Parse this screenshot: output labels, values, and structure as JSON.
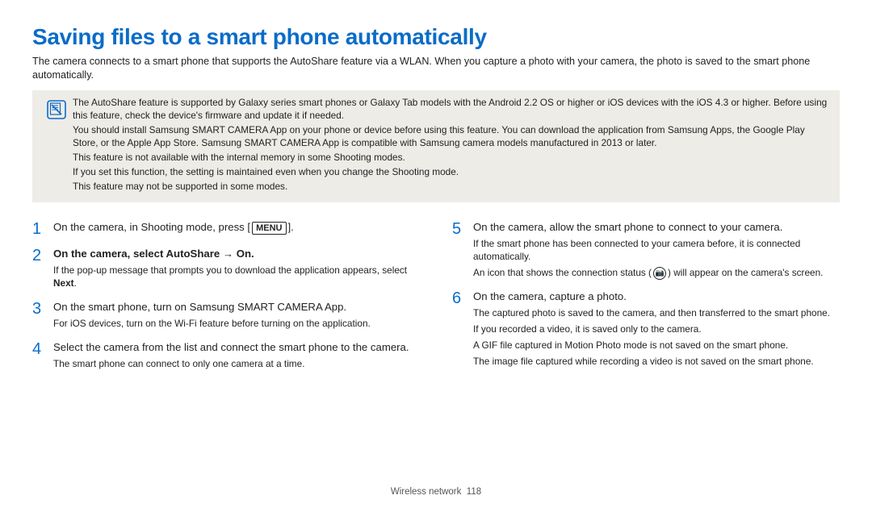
{
  "title": "Saving files to a smart phone automatically",
  "intro": "The camera connects to a smart phone that supports the AutoShare feature via a WLAN. When you capture a photo with your camera, the photo is saved to the smart phone automatically.",
  "note": {
    "lines": [
      "The AutoShare feature is supported by Galaxy series smart phones or Galaxy Tab models with the Android 2.2 OS or higher or iOS devices with the iOS 4.3 or higher. Before using this feature, check the device's firmware and update it if needed.",
      "You should install Samsung SMART CAMERA App on your phone or device before using this feature. You can download the application from Samsung Apps, the Google Play Store, or the Apple App Store. Samsung SMART CAMERA App is compatible with Samsung camera models manufactured in 2013 or later.",
      "This feature is not available with the internal memory in some Shooting modes.",
      "If you set this function, the setting is maintained even when you change the Shooting mode.",
      "This feature may not be supported in some modes."
    ]
  },
  "steps_left": [
    {
      "num": "1",
      "text_pre": "On the camera, in Shooting mode, press [",
      "icon": "MENU",
      "text_post": "].",
      "sub": ""
    },
    {
      "num": "2",
      "text_pre": "On the camera, select ",
      "bold": "AutoShare → On",
      "text_post": ".",
      "sub": "If the pop-up message that prompts you to download the application appears, select Next.",
      "sub_bold_last": "Next"
    },
    {
      "num": "3",
      "text_pre": "On the smart phone, turn on Samsung SMART CAMERA App.",
      "sub": "For iOS devices, turn on the Wi-Fi feature before turning on the application."
    },
    {
      "num": "4",
      "text_pre": "Select the camera from the list and connect the smart phone to the camera.",
      "sub": "The smart phone can connect to only one camera at a time."
    }
  ],
  "steps_right": [
    {
      "num": "5",
      "text_pre": "On the camera, allow the smart phone to connect to your camera.",
      "subs": [
        "If the smart phone has been connected to your camera before, it is connected automatically.",
        "CONN_ICON_LINE"
      ],
      "conn_line_pre": "An icon that shows the connection status (",
      "conn_line_post": ") will appear on the camera's screen."
    },
    {
      "num": "6",
      "text_pre": "On the camera, capture a photo.",
      "subs": [
        "The captured photo is saved to the camera, and then transferred to the smart phone.",
        "If you recorded a video, it is saved only to the camera.",
        "A GIF file captured in Motion Photo mode is not saved on the smart phone.",
        "The image file captured while recording a video is not saved on the smart phone."
      ]
    }
  ],
  "footer_section": "Wireless network",
  "footer_page": "118"
}
